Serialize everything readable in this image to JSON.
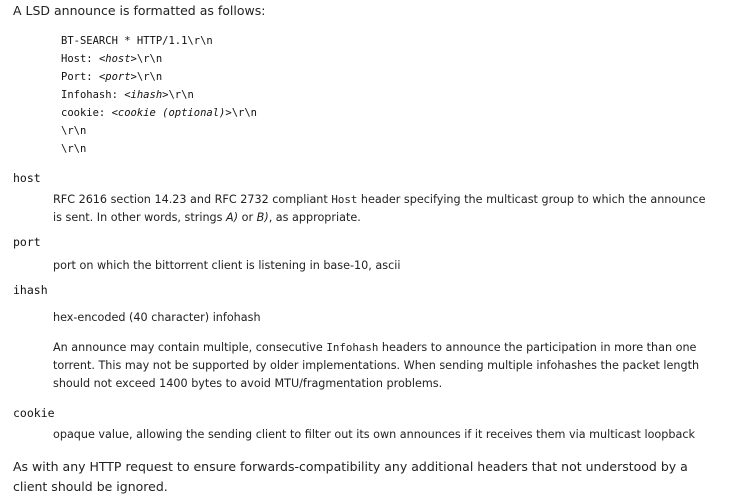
{
  "intro": "A LSD announce is formatted as follows:",
  "format": {
    "line1": "BT-SEARCH * HTTP/1.1\\r\\n",
    "host_key": "Host: ",
    "host_val": "<host>",
    "port_key": "Port: ",
    "port_val": "<port>",
    "infohash_key": "Infohash: ",
    "infohash_val": "<ihash>",
    "cookie_key": "cookie: ",
    "cookie_val": "<cookie (optional)>",
    "crlf": "\\r\\n"
  },
  "host": {
    "term": "host",
    "def_pre": "RFC 2616 section 14.23 and RFC 2732 compliant ",
    "def_code": "Host",
    "def_mid": " header specifying the multicast group to which the announce is sent. In other words, strings ",
    "def_a": "A)",
    "def_or": " or ",
    "def_b": "B)",
    "def_post": ", as appropriate."
  },
  "port": {
    "term": "port",
    "def": "port on which the bittorrent client is listening in base-10, ascii"
  },
  "ihash": {
    "term": "ihash",
    "def1": "hex-encoded (40 character) infohash",
    "def2_pre": "An announce may contain multiple, consecutive ",
    "def2_code": "Infohash",
    "def2_post": " headers to announce the participation in more than one torrent. This may not be supported by older implementations. When sending multiple infohashes the packet length should not exceed 1400 bytes to avoid MTU/fragmentation problems."
  },
  "cookie": {
    "term": "cookie",
    "def": "opaque value, allowing the sending client to filter out its own announces if it receives them via multicast loopback"
  },
  "outro": "As with any HTTP request to ensure forwards-compatibility any additional headers that not understood by a client should be ignored."
}
